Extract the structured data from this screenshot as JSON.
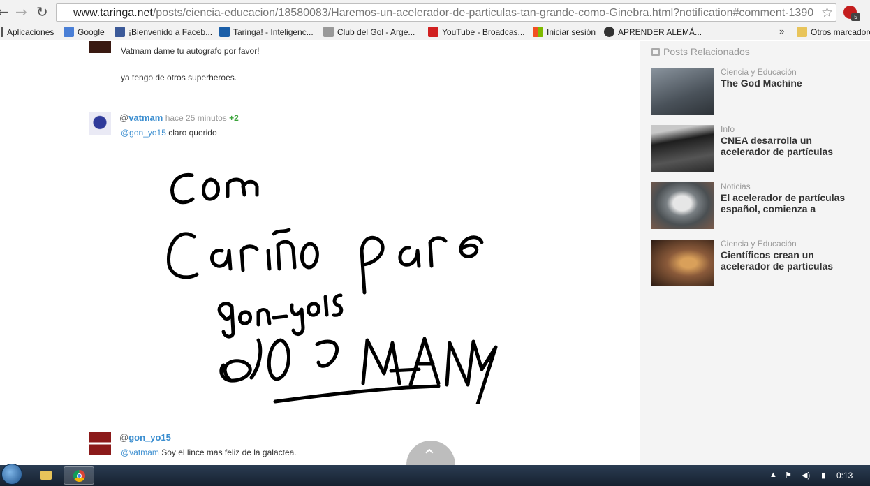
{
  "browser": {
    "url_host": "www.taringa.net",
    "url_path": "/posts/ciencia-educacion/18580083/Haremos-un-acelerador-de-particulas-tan-grande-como-Ginebra.html?notification#comment-1390",
    "ext_badge": "5",
    "bookmarks": [
      {
        "label": "Aplicaciones",
        "color": "#555555"
      },
      {
        "label": "Google",
        "color": "#4a7fd6"
      },
      {
        "label": "¡Bienvenido a Faceb...",
        "color": "#3b5998"
      },
      {
        "label": "Taringa! - Inteligenc...",
        "color": "#1a5ea8"
      },
      {
        "label": "Club del Gol - Arge...",
        "color": "#999999"
      },
      {
        "label": "YouTube - Broadcas...",
        "color": "#d12020"
      },
      {
        "label": "Iniciar sesión",
        "color": "#f25022"
      },
      {
        "label": "APRENDER ALEMÁ...",
        "color": "#333333"
      }
    ],
    "bookmarks_more": "»",
    "other_bookmarks": "Otros marcadores"
  },
  "comments": [
    {
      "text": "Vatmam dame tu autografo por favor!",
      "text2": "ya tengo de otros superheroes."
    },
    {
      "at": "@",
      "user": "vatmam",
      "time": "hace 25 minutos",
      "votes": "+2",
      "mention": "@gon_yo15",
      "text": "claro querido"
    },
    {
      "at": "@",
      "user": "gon_yo15",
      "mention": "@vatmam",
      "text": "Soy el lince mas feliz de la galactea."
    }
  ],
  "sidebar": {
    "title": "Posts Relacionados",
    "items": [
      {
        "category": "Ciencia y Educación",
        "title": "The God Machine",
        "thumb_color": "#5a6470"
      },
      {
        "category": "Info",
        "title": "CNEA desarrolla un acelerador de partículas",
        "thumb_color": "#3a3a3a"
      },
      {
        "category": "Noticias",
        "title": "El acelerador de partículas español, comienza a",
        "thumb_color": "#6a6f70"
      },
      {
        "category": "Ciencia y Educación",
        "title": "Científicos crean un acelerador de partículas",
        "thumb_color": "#6b4a32"
      }
    ]
  },
  "taskbar": {
    "clock": "0:13"
  }
}
